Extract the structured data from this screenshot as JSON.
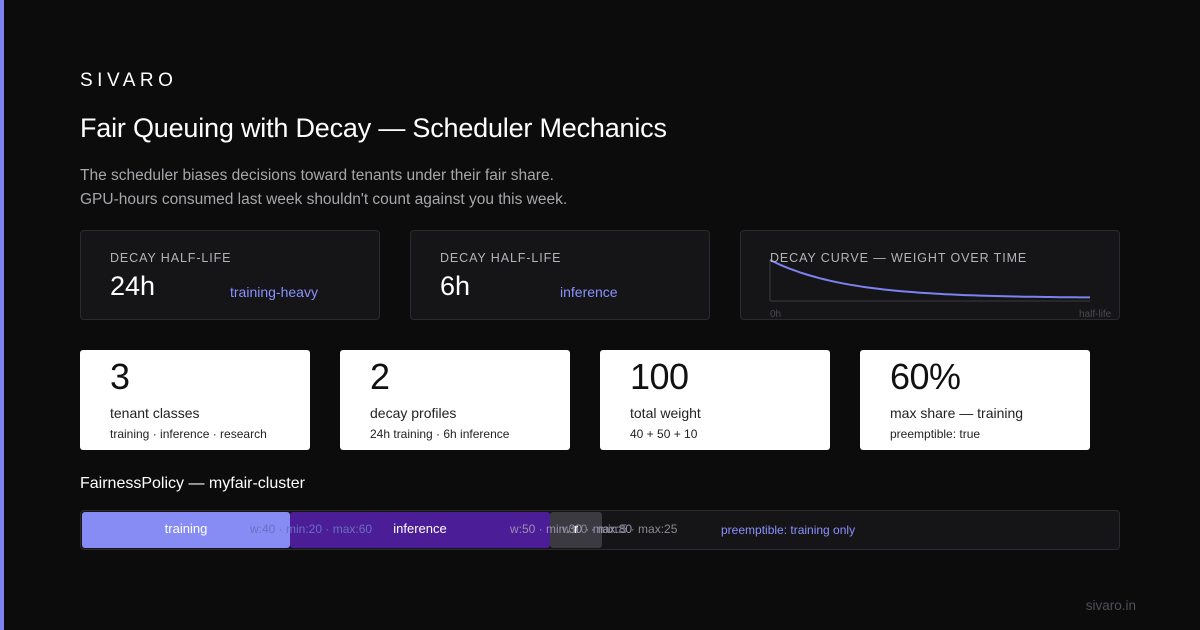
{
  "brand": "SIVARO",
  "title": "Fair Queuing with Decay — Scheduler Mechanics",
  "subtitle": [
    "The scheduler biases decisions toward tenants under their fair share.",
    "GPU-hours consumed last week shouldn't count against you this week."
  ],
  "colors": {
    "accent": "#7c82f0",
    "background": "#0c0c0d",
    "training": "#868cf3",
    "inference": "#4b1d96",
    "research": "#3a3a40",
    "link": "#8b90ff"
  },
  "decay_cards": [
    {
      "label": "DECAY HALF-LIFE",
      "value": "24h",
      "tag": "training-heavy"
    },
    {
      "label": "DECAY HALF-LIFE",
      "value": "6h",
      "tag": "inference"
    }
  ],
  "curve_card": {
    "label": "DECAY CURVE — WEIGHT OVER TIME",
    "x_start": "0h",
    "x_end": "half-life",
    "line_color": "#7c82f0"
  },
  "stats": [
    {
      "value": "3",
      "caption": "tenant classes",
      "sub": "training · inference · research"
    },
    {
      "value": "2",
      "caption": "decay profiles",
      "sub": "24h training · 6h inference"
    },
    {
      "value": "100",
      "caption": "total weight",
      "sub": "40 + 50 + 10"
    },
    {
      "value": "60%",
      "caption": "max share — training",
      "sub": "preemptible: true"
    }
  ],
  "policy": {
    "title": "FairnessPolicy — myfair-cluster",
    "segments": [
      {
        "name": "training",
        "meta": "w:40 · min:20 · max:60",
        "weight": 40
      },
      {
        "name": "inference",
        "meta": "w:50 · min:30 · max:80",
        "weight": 50
      },
      {
        "name": "r",
        "meta": "w:10 · min:5 · max:25",
        "weight": 10
      }
    ],
    "note": "preemptible: training only"
  },
  "footer": "sivaro.in"
}
